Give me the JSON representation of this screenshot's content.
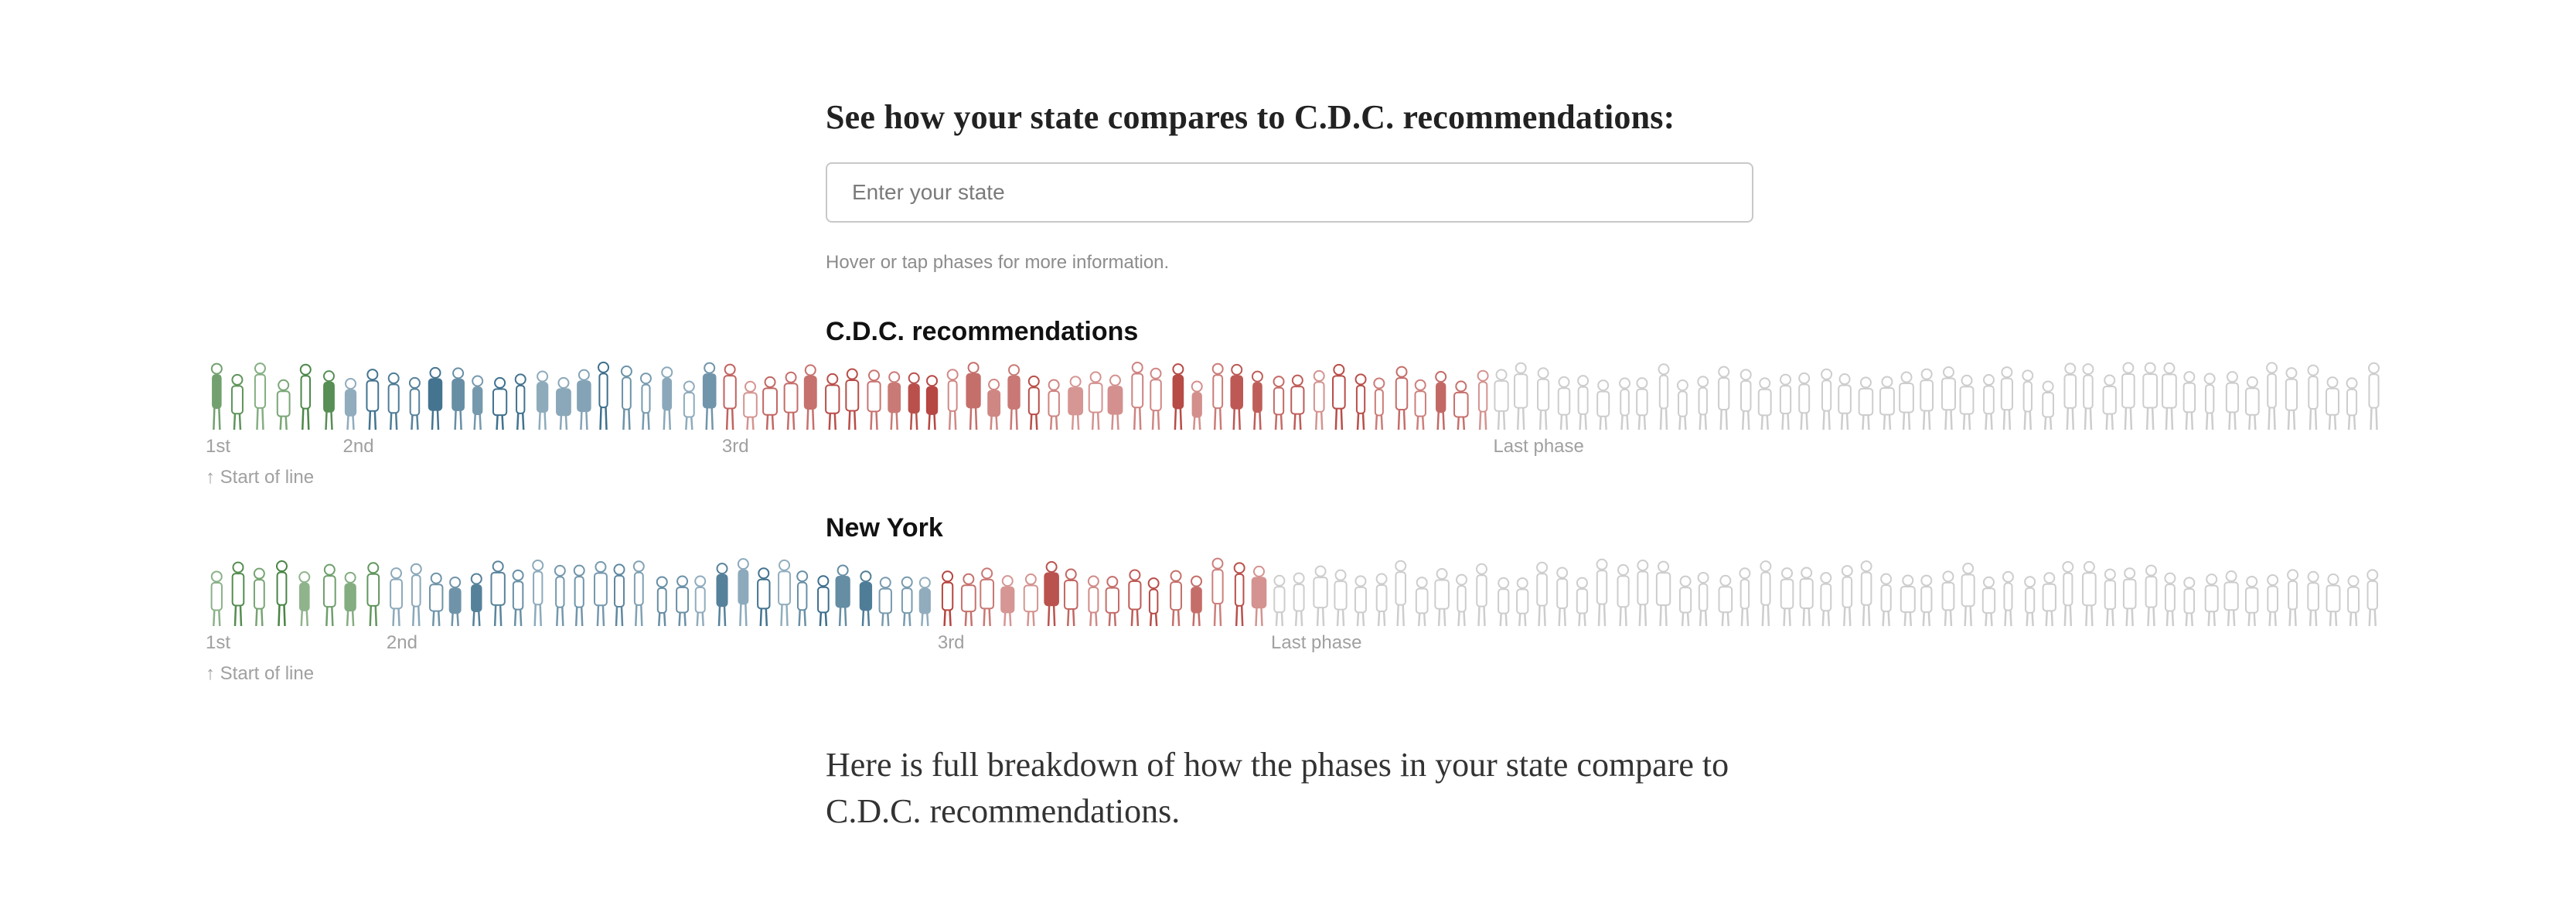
{
  "heading": "See how your state compares to C.D.C. recommendations:",
  "search": {
    "placeholder": "Enter your state",
    "value": ""
  },
  "hint": "Hover or tap phases for more information.",
  "rows": [
    {
      "title": "C.D.C. recommendations",
      "phases": [
        {
          "label": "1st",
          "share": 0.063,
          "color": "#3f7f3b"
        },
        {
          "label": "2nd",
          "share": 0.174,
          "color": "#3d6f8c"
        },
        {
          "label": "3rd",
          "share": 0.354,
          "color": "#b4423d"
        },
        {
          "label": "Last phase",
          "share": 0.409,
          "color": "#bdbdbd"
        }
      ]
    },
    {
      "title": "New York",
      "phases": [
        {
          "label": "1st",
          "share": 0.083,
          "color": "#3f7f3b"
        },
        {
          "label": "2nd",
          "share": 0.253,
          "color": "#3d6f8c"
        },
        {
          "label": "3rd",
          "share": 0.153,
          "color": "#b4423d"
        },
        {
          "label": "Last phase",
          "share": 0.511,
          "color": "#bdbdbd"
        }
      ]
    }
  ],
  "start_note": "↑ Start of line",
  "breakdown": "Here is full breakdown of how the phases in your state compare to C.D.C. recommendations."
}
